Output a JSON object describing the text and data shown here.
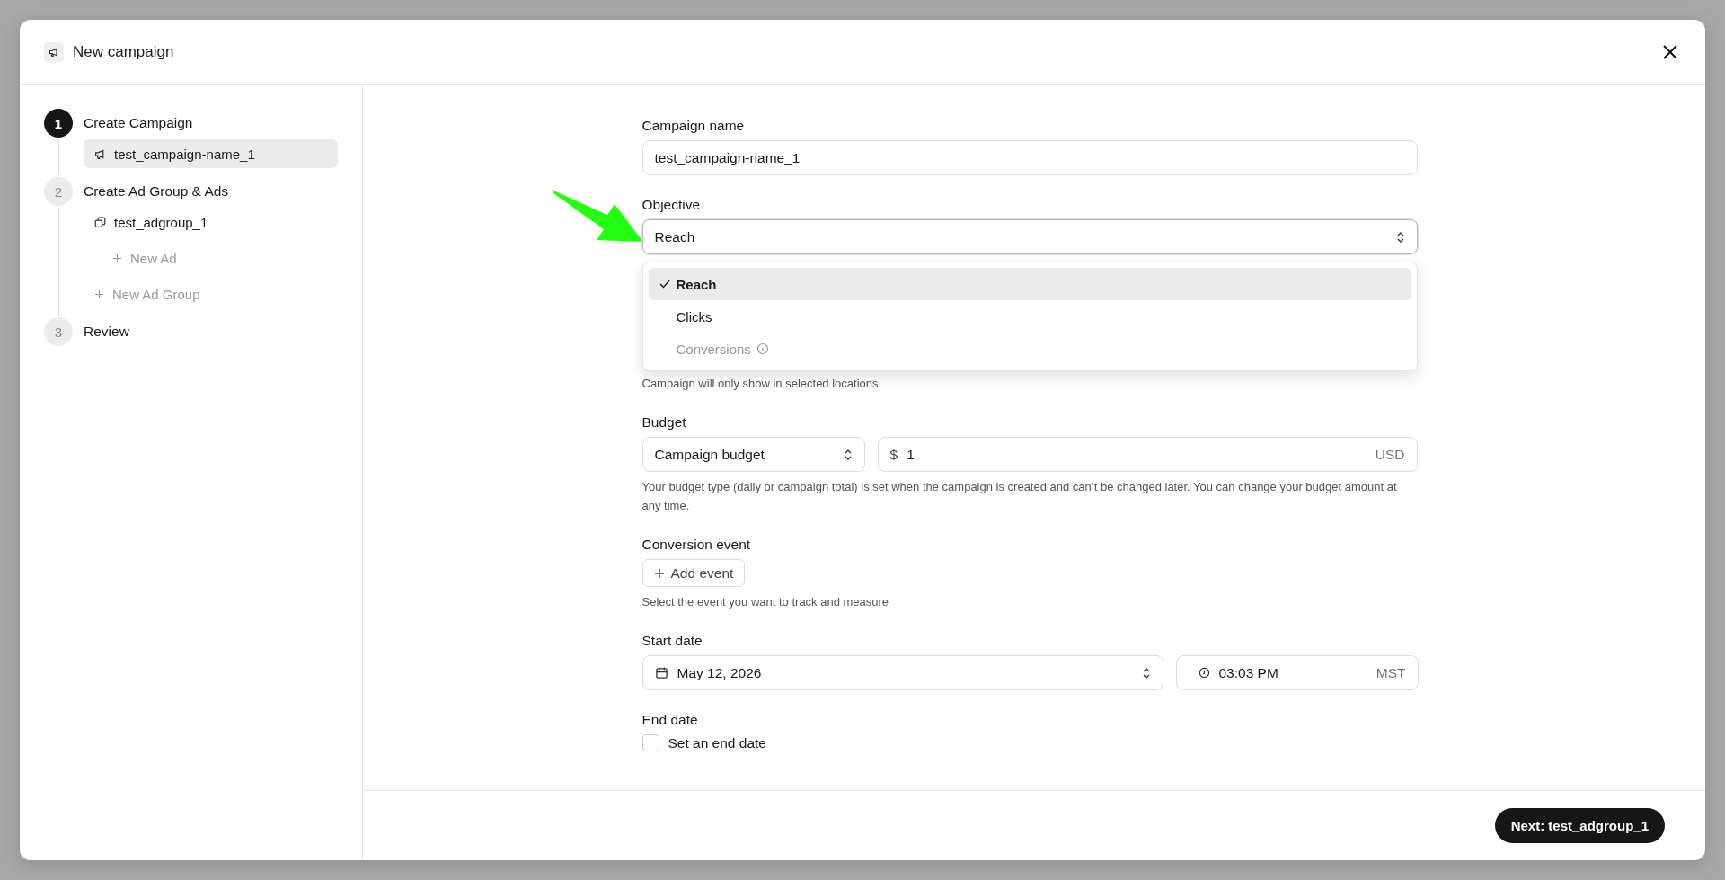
{
  "dialog": {
    "title": "New campaign"
  },
  "steps": [
    {
      "number": "1",
      "label": "Create Campaign",
      "selected": true,
      "children": [
        {
          "kind": "campaign",
          "label": "test_campaign-name_1",
          "selected": true
        }
      ]
    },
    {
      "number": "2",
      "label": "Create Ad Group & Ads",
      "selected": false,
      "children": [
        {
          "kind": "adgroup",
          "label": "test_adgroup_1",
          "selected": false,
          "children": [
            {
              "kind": "add",
              "label": "New Ad",
              "selected": false
            }
          ]
        },
        {
          "kind": "add",
          "label": "New Ad Group",
          "selected": false
        }
      ]
    },
    {
      "number": "3",
      "label": "Review",
      "selected": false
    }
  ],
  "form": {
    "campaign_name": {
      "label": "Campaign name",
      "value": "test_campaign-name_1"
    },
    "objective": {
      "label": "Objective",
      "value": "Reach",
      "expanded": true,
      "options": [
        {
          "label": "Reach",
          "selected": true,
          "disabled": false
        },
        {
          "label": "Clicks",
          "selected": false,
          "disabled": false
        },
        {
          "label": "Conversions",
          "selected": false,
          "disabled": true
        }
      ]
    },
    "locations_help": "Campaign will only show in selected locations.",
    "budget": {
      "label": "Budget",
      "type": "Campaign budget",
      "currency_symbol": "$",
      "amount": "1",
      "currency": "USD",
      "help": "Your budget type (daily or campaign total) is set when the campaign is created and can’t be changed later. You can change your budget amount at any time."
    },
    "conversion_event": {
      "label": "Conversion event",
      "button": "Add event",
      "help": "Select the event you want to track and measure"
    },
    "start_date": {
      "label": "Start date",
      "date": "May 12, 2026",
      "time": "03:03 PM",
      "timezone": "MST"
    },
    "end_date": {
      "label": "End date",
      "checkbox_label": "Set an end date",
      "checked": false
    }
  },
  "footer": {
    "next_button": "Next: test_adgroup_1"
  }
}
